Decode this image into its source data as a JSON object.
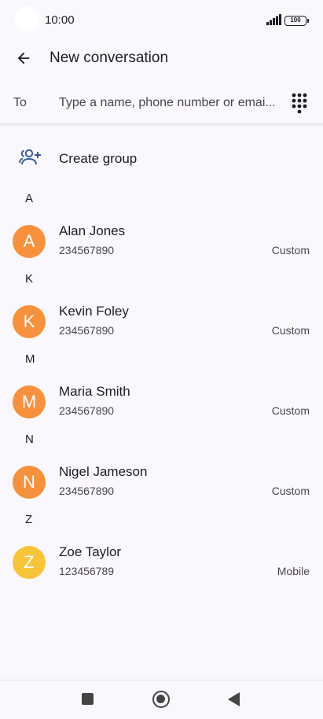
{
  "status_bar": {
    "time": "10:00",
    "battery": "100"
  },
  "header": {
    "title": "New conversation"
  },
  "to_field": {
    "label": "To",
    "placeholder": "Type a name, phone number or emai..."
  },
  "create_group": {
    "label": "Create group"
  },
  "colors": {
    "orange_avatar": "#f7913d",
    "yellow_avatar": "#f8c43a",
    "accent": "#3c5a98"
  },
  "sections": [
    {
      "letter": "A",
      "contacts": [
        {
          "initial": "A",
          "name": "Alan Jones",
          "number": "234567890",
          "type": "Custom"
        }
      ]
    },
    {
      "letter": "K",
      "contacts": [
        {
          "initial": "K",
          "name": "Kevin Foley",
          "number": "234567890",
          "type": "Custom"
        }
      ]
    },
    {
      "letter": "M",
      "contacts": [
        {
          "initial": "M",
          "name": "Maria Smith",
          "number": "234567890",
          "type": "Custom"
        }
      ]
    },
    {
      "letter": "N",
      "contacts": [
        {
          "initial": "N",
          "name": "Nigel Jameson",
          "number": "234567890",
          "type": "Custom"
        }
      ]
    },
    {
      "letter": "Z",
      "contacts": [
        {
          "initial": "Z",
          "name": "Zoe Taylor",
          "number": "123456789",
          "type": "Mobile"
        }
      ]
    }
  ]
}
